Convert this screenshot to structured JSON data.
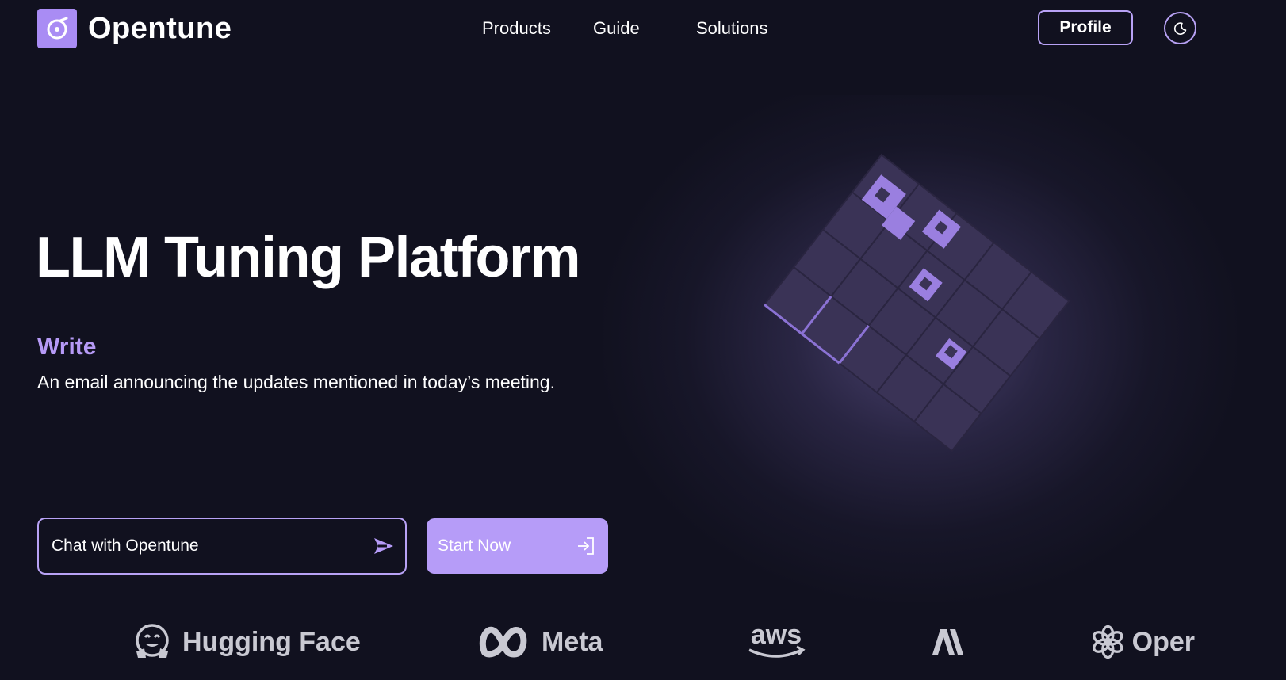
{
  "header": {
    "brand": "Opentune",
    "nav": [
      {
        "label": "Products"
      },
      {
        "label": "Guide"
      },
      {
        "label": "Solutions"
      }
    ],
    "profile_label": "Profile",
    "theme_icon": "moon-icon"
  },
  "hero": {
    "title": "LLM Tuning Platform",
    "write_label": "Write",
    "write_text": "An email announcing the updates mentioned in today’s meeting.",
    "chat_placeholder": "Chat with Opentune",
    "chat_send_icon": "send-icon",
    "start_label": "Start Now",
    "start_icon": "login-arrow-icon",
    "art_icon": "cube-grid-art"
  },
  "partners": [
    {
      "name": "Hugging Face",
      "icon": "hugging-face-logo"
    },
    {
      "name": "Meta",
      "icon": "meta-logo"
    },
    {
      "name": "aws",
      "icon": "aws-logo"
    },
    {
      "name": "AI",
      "icon": "anthropic-logo"
    },
    {
      "name": "Oper",
      "icon": "openai-logo"
    }
  ],
  "colors": {
    "background": "#11111f",
    "accent": "#b69cf8",
    "accent_border": "#b8a2f5",
    "text": "#ffffff",
    "partner_text": "#c9c9d2"
  }
}
